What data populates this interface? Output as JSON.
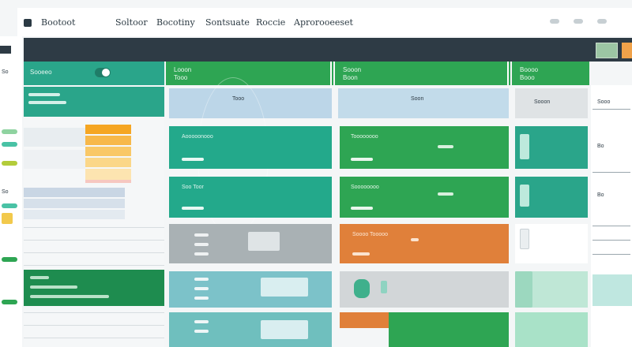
{
  "topbar": {
    "menu": [
      "Bootoot",
      "Soltoor",
      "Bocotiny",
      "Sontsuate",
      "Roccie",
      "Aprorooeeset"
    ]
  },
  "sidebar": {
    "head_label": "Sooeeo",
    "toggle_on": true,
    "left_labels": [
      "So",
      "So"
    ]
  },
  "columns": [
    {
      "label_top": "Looon",
      "label_bottom": "Tooo"
    },
    {
      "label_top": "Sooon",
      "label_bottom": "Boon"
    },
    {
      "label_top": "Boooo",
      "label_bottom": "Booo"
    }
  ],
  "cells": {
    "row1_col1": "Aooooonooo",
    "row1_col2": "Toooooooo",
    "row2_col1": "Soo Toor",
    "row2_col2": "Soooooooo",
    "row3_col2": "Soooo Tooooo",
    "row0_col1_small": "Tooo",
    "row0_col2_small": "Soon",
    "row0_col3_small": "Sooon"
  },
  "rightcol": {
    "items": [
      "Sooo",
      "Bo",
      "Bo"
    ]
  },
  "colors": {
    "teal": "#2aa58a",
    "green": "#2ea553",
    "dark_green": "#1e8c4f",
    "orange": "#e0803a",
    "navy": "#2e3b45",
    "grey": "#a9b1b4",
    "light_blue": "#bcd6e8"
  }
}
